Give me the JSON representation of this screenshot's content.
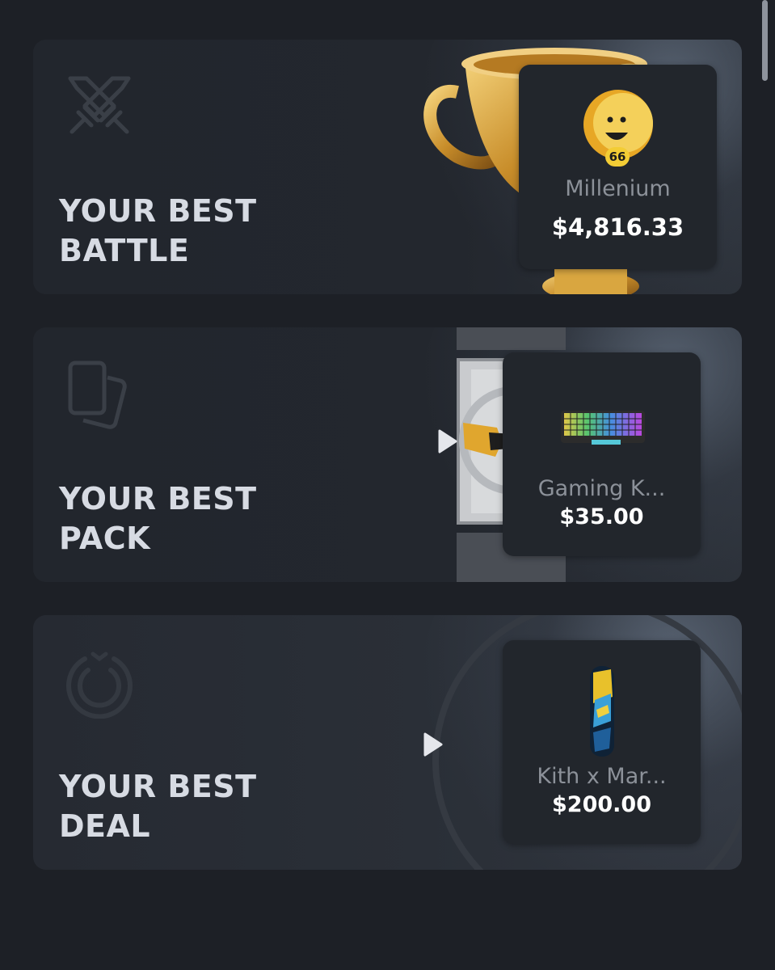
{
  "cards": {
    "battle": {
      "title_line1": "YOUR BEST",
      "title_line2": "BATTLE",
      "icon": "crossed-swords-icon",
      "reward": {
        "name": "Millenium",
        "price": "$4,816.33",
        "badge": "66"
      }
    },
    "pack": {
      "title_line1": "YOUR BEST",
      "title_line2": "PACK",
      "icon": "cards-icon",
      "reward": {
        "name": "Gaming K...",
        "price": "$35.00"
      }
    },
    "deal": {
      "title_line1": "YOUR BEST",
      "title_line2": "DEAL",
      "icon": "power-ring-icon",
      "reward": {
        "name": "Kith x Mar...",
        "price": "$200.00"
      }
    }
  },
  "colors": {
    "background": "#1d2026",
    "card": "#22262d",
    "title": "#d7dbe3",
    "name": "#8c9199",
    "price": "#ffffff",
    "gold": "#d9a640"
  }
}
